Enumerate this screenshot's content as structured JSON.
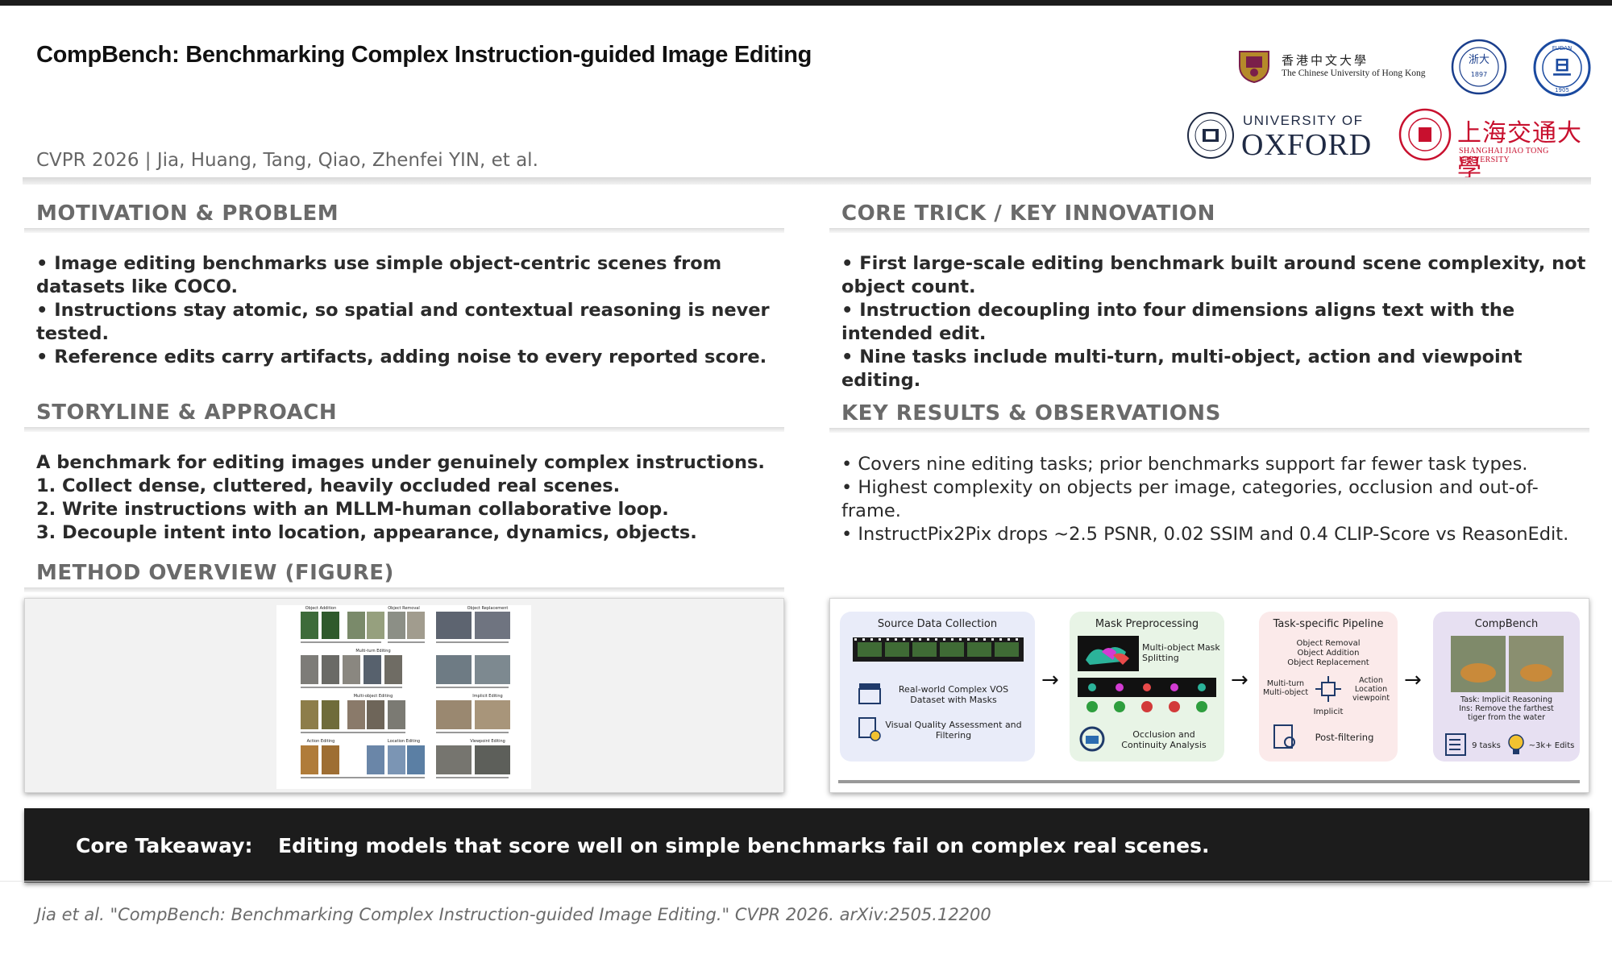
{
  "header": {
    "title": "CompBench: Benchmarking Complex Instruction-guided Image Editing",
    "venue": "CVPR 2026 | Jia, Huang, Tang, Qiao, Zhenfei YIN, et al."
  },
  "logos": {
    "cuhk": {
      "zh": "香港中文大學",
      "en": "The Chinese University of Hong Kong"
    },
    "zju": "Zhejiang University",
    "fudan": "FUDAN UNIVERSITY",
    "oxford": {
      "top": "UNIVERSITY OF",
      "main": "OXFORD"
    },
    "sjtu": {
      "zh": "上海交通大學",
      "en": "SHANGHAI JIAO TONG UNIVERSITY"
    }
  },
  "motivation": {
    "title": "MOTIVATION & PROBLEM",
    "bullets": [
      "•  Image editing benchmarks use simple object-centric scenes from datasets like COCO.",
      "•  Instructions stay atomic, so spatial and contextual reasoning is never tested.",
      "•  Reference edits carry artifacts, adding noise to every reported score."
    ]
  },
  "core": {
    "title": "CORE TRICK / KEY INNOVATION",
    "bullets": [
      "•  First large-scale editing benchmark built around scene complexity, not object count.",
      "•  Instruction decoupling into four dimensions aligns text with the intended edit.",
      "•  Nine tasks include multi-turn, multi-object, action and viewpoint editing."
    ]
  },
  "storyline": {
    "title": "STORYLINE & APPROACH",
    "lines": [
      "A benchmark for editing images under genuinely complex instructions.",
      "1. Collect dense, cluttered, heavily occluded real scenes.",
      "2. Write instructions with an MLLM-human collaborative loop.",
      "3. Decouple intent into location, appearance, dynamics, objects."
    ]
  },
  "results": {
    "title": "KEY RESULTS & OBSERVATIONS",
    "bullets": [
      "•  Covers nine editing tasks; prior benchmarks support far fewer task types.",
      "•  Highest complexity on objects per image, categories, occlusion and out-of-frame.",
      "•  InstructPix2Pix drops ~2.5 PSNR, 0.02 SSIM and 0.4 CLIP-Score vs ReasonEdit."
    ]
  },
  "method": {
    "title": "METHOD OVERVIEW (FIGURE)",
    "grid_headers": [
      "Object Addition",
      "Object Removal",
      "Object Replacement",
      "Multi-turn Editing",
      "Multi-object Editing",
      "Implicit Editing",
      "Action Editing",
      "Location Editing",
      "Viewpoint Editing"
    ]
  },
  "pipeline": {
    "stage1": {
      "title": "Source Data Collection",
      "item1": "Real-world Complex VOS Dataset with Masks",
      "item2": "Visual Quality Assessment and Filtering"
    },
    "stage2": {
      "title": "Mask Preprocessing",
      "item1": "Multi-object Mask Splitting",
      "item2": "Occlusion and Continuity Analysis"
    },
    "stage3": {
      "title": "Task-specific Pipeline",
      "list1": "Object Removal",
      "list2": "Object Addition",
      "list3": "Object Replacement",
      "left": "Multi-turn Multi-object",
      "right": "Action Location viewpoint",
      "bottom": "Implicit",
      "item": "Post-filtering"
    },
    "stage4": {
      "title": "CompBench",
      "task": "Task: Implicit Reasoning",
      "ins": "Ins: Remove the farthest tiger from the water",
      "tasks": "9 tasks",
      "edits": "~3k+ Edits"
    }
  },
  "takeaway": {
    "label": "Core Takeaway:",
    "text": "Editing models that score well on simple benchmarks fail on complex real scenes."
  },
  "citation": "Jia et al. \"CompBench: Benchmarking Complex Instruction-guided Image Editing.\" CVPR 2026. arXiv:2505.12200",
  "colors": {
    "stage1": "#e9ecf9",
    "stage2": "#e8f4e6",
    "stage3": "#fbeaea",
    "stage4": "#e7e0f2",
    "takeaway_bg": "#1c1c1c"
  }
}
